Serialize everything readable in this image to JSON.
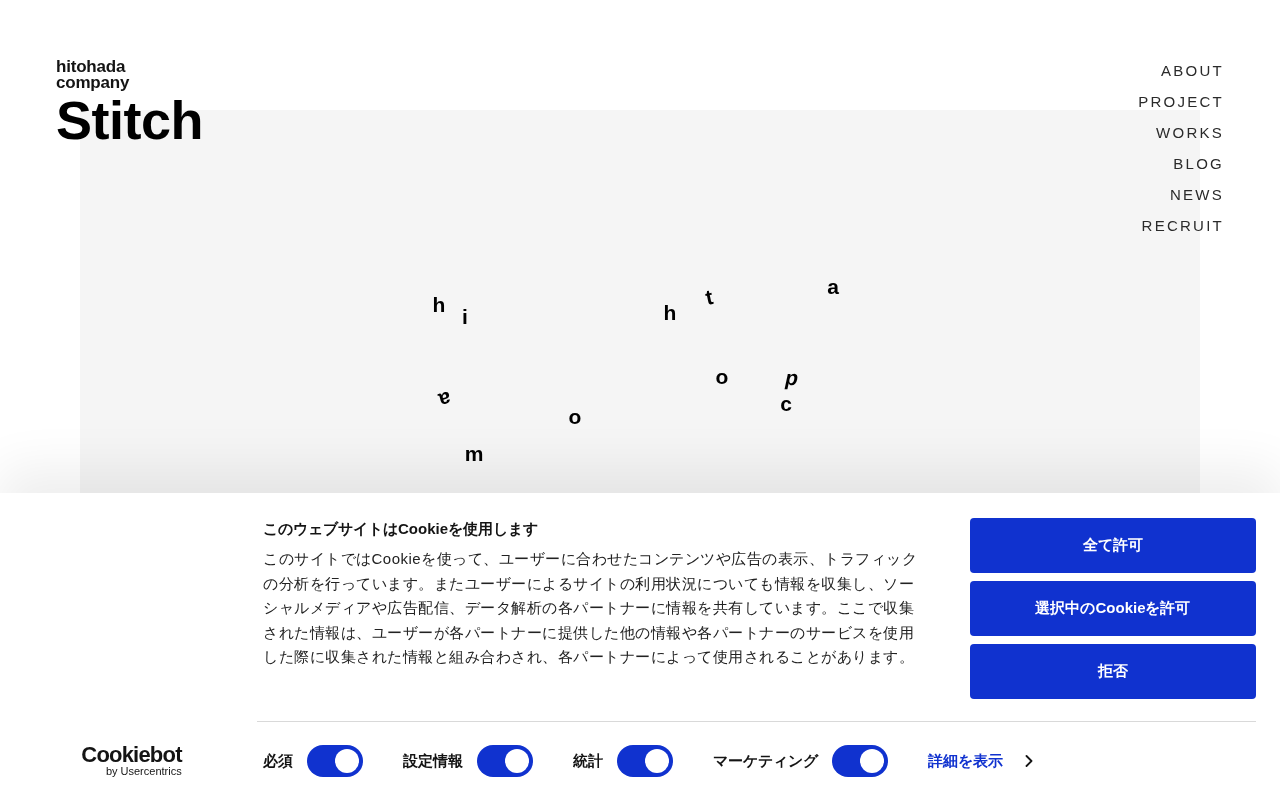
{
  "header": {
    "logo": {
      "line_1": "hitohada",
      "line_2": "company",
      "wordmark": "Stitch"
    },
    "nav": [
      "ABOUT",
      "PROJECT",
      "WORKS",
      "BLOG",
      "NEWS",
      "RECRUIT"
    ]
  },
  "hero": {
    "letters": [
      "h",
      "i",
      "h",
      "t",
      "a",
      "o",
      "p",
      "c",
      "a",
      "o",
      "m"
    ]
  },
  "cookie_banner": {
    "title": "このウェブサイトはCookieを使用します",
    "body": "このサイトではCookieを使って、ユーザーに合わせたコンテンツや広告の表示、トラフィックの分析を行っています。またユーザーによるサイトの利用状況についても情報を収集し、ソーシャルメディアや広告配信、データ解析の各パートナーに情報を共有しています。ここで収集された情報は、ユーザーが各パートナーに提供した他の情報や各パートナーのサービスを使用した際に収集された情報と組み合わされ、各パートナーによって使用されることがあります。",
    "buttons": [
      "全て許可",
      "選択中のCookieを許可",
      "拒否"
    ],
    "branding": {
      "name": "Cookiebot",
      "tagline": "by Usercentrics"
    },
    "toggles": [
      {
        "label": "必須",
        "on": true
      },
      {
        "label": "設定情報",
        "on": true
      },
      {
        "label": "統計",
        "on": true
      },
      {
        "label": "マーケティング",
        "on": true
      }
    ],
    "details_link": "詳細を表示"
  }
}
